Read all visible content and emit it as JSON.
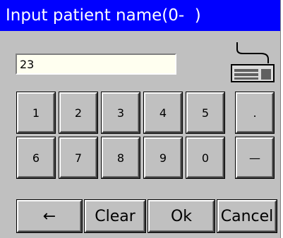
{
  "dialog": {
    "title": "Input patient name(0-  )",
    "input": {
      "value": "23",
      "placeholder": ""
    },
    "keyboard_icon": "keyboard-icon",
    "keys_row1": [
      "1",
      "2",
      "3",
      "4",
      "5"
    ],
    "keys_row2": [
      "6",
      "7",
      "8",
      "9",
      "0"
    ],
    "dot_key": ".",
    "dash_key": "—",
    "backspace_label": "←",
    "clear_label": "Clear",
    "ok_label": "Ok",
    "cancel_label": "Cancel"
  },
  "colors": {
    "titlebar": "#0000ff",
    "face": "#c0c0c0",
    "input_bg": "#fffff0"
  }
}
